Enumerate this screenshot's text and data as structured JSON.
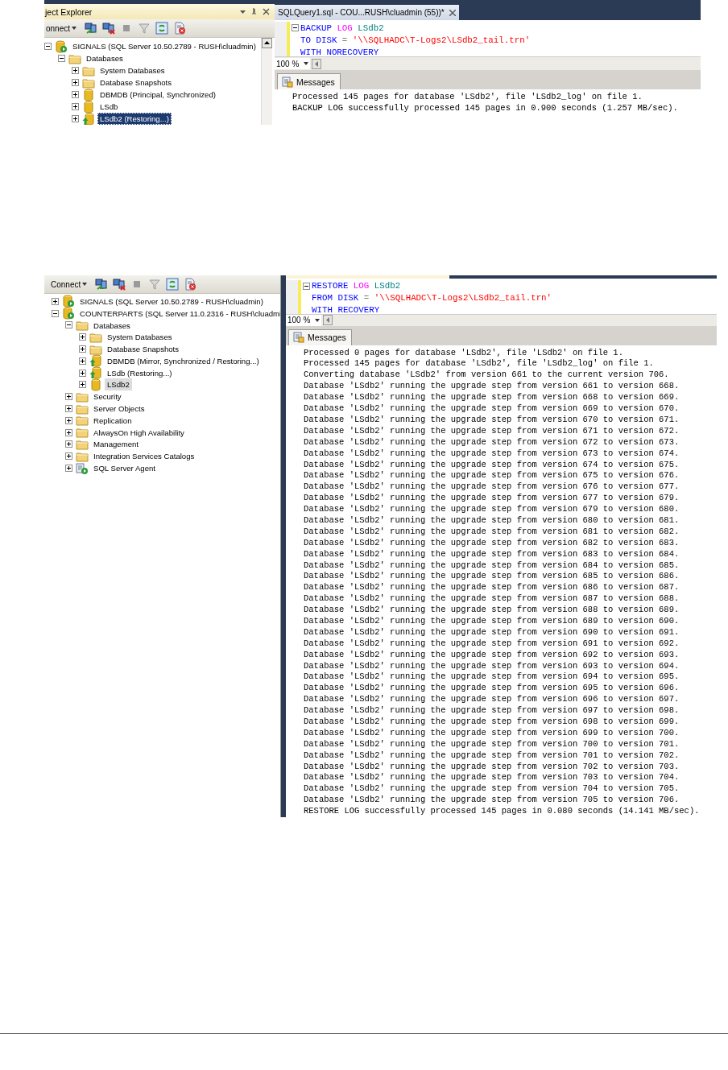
{
  "screenshots": [
    {
      "explorer": {
        "title": "ject Explorer",
        "active": true,
        "connect": "onnect",
        "scrollbar": true,
        "tree": [
          {
            "label": "SIGNALS (SQL Server 10.50.2789 - RUSH\\cluadmin)",
            "kind": "server",
            "expanded": true,
            "selected": false,
            "children": [
              {
                "label": "Databases",
                "kind": "folder",
                "expanded": true,
                "selected": false,
                "children": [
                  {
                    "label": "System Databases",
                    "kind": "folder",
                    "expanded": false,
                    "selected": false
                  },
                  {
                    "label": "Database Snapshots",
                    "kind": "folder",
                    "expanded": false,
                    "selected": false
                  },
                  {
                    "label": "DBMDB (Principal, Synchronized)",
                    "kind": "database",
                    "expanded": false,
                    "selected": false
                  },
                  {
                    "label": "LSdb",
                    "kind": "database",
                    "expanded": false,
                    "selected": false
                  },
                  {
                    "label": "LSdb2 (Restoring...)",
                    "kind": "restoring",
                    "expanded": false,
                    "selected": true
                  }
                ]
              }
            ]
          }
        ]
      },
      "query_tab": "SQLQuery1.sql - COU...RUSH\\cluadmin (55))*",
      "code": [
        {
          "collapse": true,
          "tokens": [
            {
              "kind": "keyword",
              "text": "BACKUP"
            },
            {
              "kind": "system",
              "text": "LOG"
            },
            {
              "kind": "name",
              "text": "LSdb2"
            }
          ]
        },
        {
          "collapse": false,
          "tokens": [
            {
              "kind": "keyword",
              "text": "TO"
            },
            {
              "kind": "keyword",
              "text": "DISK"
            },
            {
              "kind": "operator",
              "text": "="
            },
            {
              "kind": "string",
              "text": "'\\\\SQLHADC\\T-Logs2\\LSdb2_tail.trn'"
            }
          ]
        },
        {
          "collapse": false,
          "tokens": [
            {
              "kind": "keyword",
              "text": "WITH"
            },
            {
              "kind": "keyword",
              "text": "NORECOVERY"
            }
          ]
        }
      ],
      "zoom": "100 %",
      "results_tab": "Messages",
      "messages": [
        "Processed 145 pages for database 'LSdb2', file 'LSdb2_log' on file 1.",
        "BACKUP LOG successfully processed 145 pages in 0.900 seconds (1.257 MB/sec)."
      ]
    },
    {
      "explorer": {
        "active": false,
        "connect": "Connect",
        "scrollbar": false,
        "tree": [
          {
            "label": "SIGNALS (SQL Server 10.50.2789 - RUSH\\cluadmin)",
            "kind": "server",
            "expanded": false,
            "selected": false
          },
          {
            "label": "COUNTERPARTS (SQL Server 11.0.2316 - RUSH\\cluadmi",
            "kind": "server",
            "expanded": true,
            "selected": false,
            "children": [
              {
                "label": "Databases",
                "kind": "folder",
                "expanded": true,
                "selected": false,
                "children": [
                  {
                    "label": "System Databases",
                    "kind": "folder",
                    "expanded": false,
                    "selected": false
                  },
                  {
                    "label": "Database Snapshots",
                    "kind": "folder",
                    "expanded": false,
                    "selected": false
                  },
                  {
                    "label": "DBMDB (Mirror, Synchronized / Restoring...)",
                    "kind": "restoring",
                    "expanded": false,
                    "selected": false
                  },
                  {
                    "label": "LSdb (Restoring...)",
                    "kind": "restoring",
                    "expanded": false,
                    "selected": false
                  },
                  {
                    "label": "LSdb2",
                    "kind": "database",
                    "expanded": false,
                    "selected": true
                  }
                ]
              },
              {
                "label": "Security",
                "kind": "folder",
                "expanded": false,
                "selected": false
              },
              {
                "label": "Server Objects",
                "kind": "folder",
                "expanded": false,
                "selected": false
              },
              {
                "label": "Replication",
                "kind": "folder",
                "expanded": false,
                "selected": false
              },
              {
                "label": "AlwaysOn High Availability",
                "kind": "folder",
                "expanded": false,
                "selected": false
              },
              {
                "label": "Management",
                "kind": "folder",
                "expanded": false,
                "selected": false
              },
              {
                "label": "Integration Services Catalogs",
                "kind": "folder",
                "expanded": false,
                "selected": false
              },
              {
                "label": "SQL Server Agent",
                "kind": "agent",
                "expanded": false,
                "selected": false
              }
            ]
          }
        ]
      },
      "code": [
        {
          "collapse": true,
          "tokens": [
            {
              "kind": "keyword",
              "text": "RESTORE"
            },
            {
              "kind": "system",
              "text": "LOG"
            },
            {
              "kind": "name",
              "text": "LSdb2"
            }
          ]
        },
        {
          "collapse": false,
          "tokens": [
            {
              "kind": "keyword",
              "text": "FROM"
            },
            {
              "kind": "keyword",
              "text": "DISK"
            },
            {
              "kind": "operator",
              "text": "="
            },
            {
              "kind": "string",
              "text": "'\\\\SQLHADC\\T-Logs2\\LSdb2_tail.trn'"
            }
          ]
        },
        {
          "collapse": false,
          "tokens": [
            {
              "kind": "keyword",
              "text": "WITH"
            },
            {
              "kind": "keyword",
              "text": "RECOVERY"
            }
          ]
        }
      ],
      "zoom": "100 %",
      "results_tab": "Messages",
      "messages": [
        "Processed 0 pages for database 'LSdb2', file 'LSdb2' on file 1.",
        "Processed 145 pages for database 'LSdb2', file 'LSdb2_log' on file 1.",
        "Converting database 'LSdb2' from version 661 to the current version 706.",
        "Database 'LSdb2' running the upgrade step from version 661 to version 668.",
        "Database 'LSdb2' running the upgrade step from version 668 to version 669.",
        "Database 'LSdb2' running the upgrade step from version 669 to version 670.",
        "Database 'LSdb2' running the upgrade step from version 670 to version 671.",
        "Database 'LSdb2' running the upgrade step from version 671 to version 672.",
        "Database 'LSdb2' running the upgrade step from version 672 to version 673.",
        "Database 'LSdb2' running the upgrade step from version 673 to version 674.",
        "Database 'LSdb2' running the upgrade step from version 674 to version 675.",
        "Database 'LSdb2' running the upgrade step from version 675 to version 676.",
        "Database 'LSdb2' running the upgrade step from version 676 to version 677.",
        "Database 'LSdb2' running the upgrade step from version 677 to version 679.",
        "Database 'LSdb2' running the upgrade step from version 679 to version 680.",
        "Database 'LSdb2' running the upgrade step from version 680 to version 681.",
        "Database 'LSdb2' running the upgrade step from version 681 to version 682.",
        "Database 'LSdb2' running the upgrade step from version 682 to version 683.",
        "Database 'LSdb2' running the upgrade step from version 683 to version 684.",
        "Database 'LSdb2' running the upgrade step from version 684 to version 685.",
        "Database 'LSdb2' running the upgrade step from version 685 to version 686.",
        "Database 'LSdb2' running the upgrade step from version 686 to version 687.",
        "Database 'LSdb2' running the upgrade step from version 687 to version 688.",
        "Database 'LSdb2' running the upgrade step from version 688 to version 689.",
        "Database 'LSdb2' running the upgrade step from version 689 to version 690.",
        "Database 'LSdb2' running the upgrade step from version 690 to version 691.",
        "Database 'LSdb2' running the upgrade step from version 691 to version 692.",
        "Database 'LSdb2' running the upgrade step from version 692 to version 693.",
        "Database 'LSdb2' running the upgrade step from version 693 to version 694.",
        "Database 'LSdb2' running the upgrade step from version 694 to version 695.",
        "Database 'LSdb2' running the upgrade step from version 695 to version 696.",
        "Database 'LSdb2' running the upgrade step from version 696 to version 697.",
        "Database 'LSdb2' running the upgrade step from version 697 to version 698.",
        "Database 'LSdb2' running the upgrade step from version 698 to version 699.",
        "Database 'LSdb2' running the upgrade step from version 699 to version 700.",
        "Database 'LSdb2' running the upgrade step from version 700 to version 701.",
        "Database 'LSdb2' running the upgrade step from version 701 to version 702.",
        "Database 'LSdb2' running the upgrade step from version 702 to version 703.",
        "Database 'LSdb2' running the upgrade step from version 703 to version 704.",
        "Database 'LSdb2' running the upgrade step from version 704 to version 705.",
        "Database 'LSdb2' running the upgrade step from version 705 to version 706.",
        "RESTORE LOG successfully processed 145 pages in 0.080 seconds (14.141 MB/sec)."
      ]
    }
  ]
}
